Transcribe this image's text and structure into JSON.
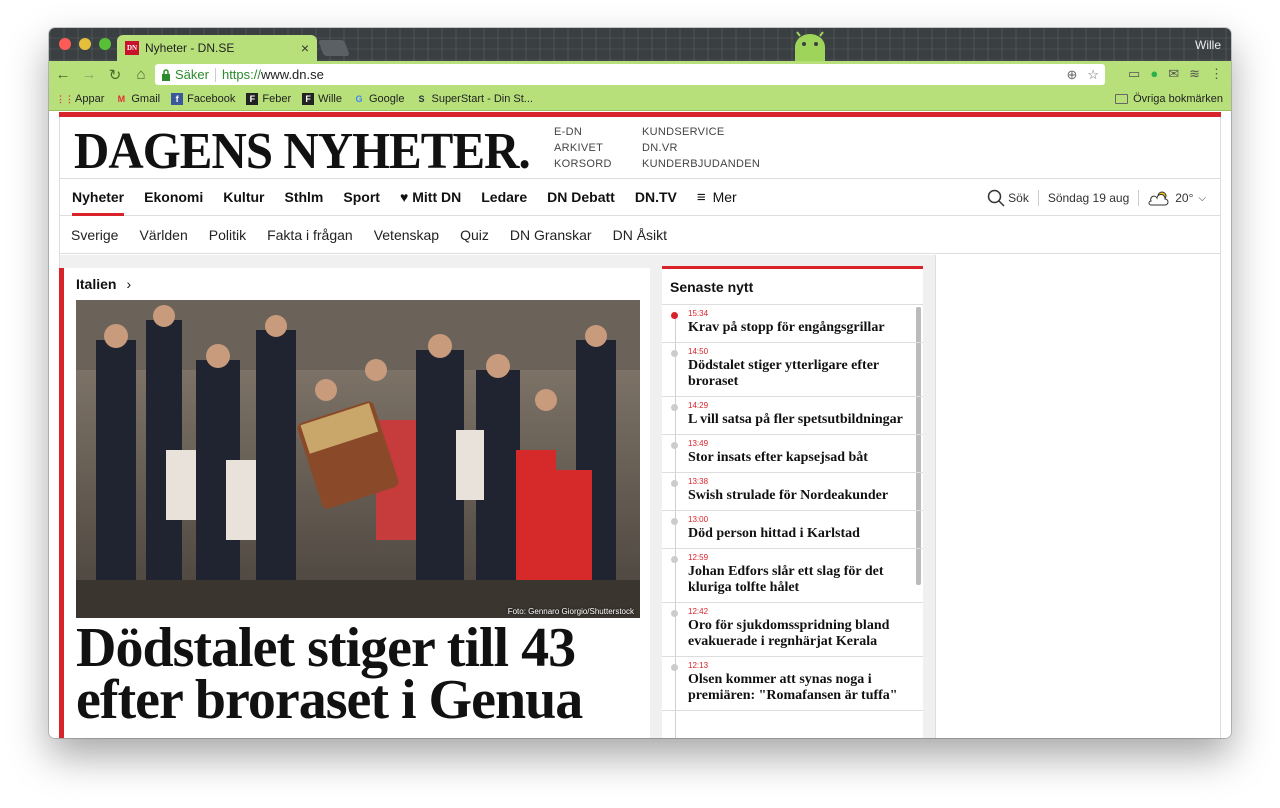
{
  "browser": {
    "tab_title": "Nyheter - DN.SE",
    "tab_close": "×",
    "favicon_text": "DN",
    "user": "Wille",
    "secure_label": "Säker",
    "url_proto": "https://",
    "url_host": "www.dn.se"
  },
  "bookmarks": {
    "items": [
      {
        "label": "Appar",
        "icon": "apps-grid-icon"
      },
      {
        "label": "Gmail",
        "icon": "gmail-icon"
      },
      {
        "label": "Facebook",
        "icon": "facebook-icon"
      },
      {
        "label": "Feber",
        "icon": "feber-icon"
      },
      {
        "label": "Wille",
        "icon": "wille-icon"
      },
      {
        "label": "Google",
        "icon": "google-icon"
      },
      {
        "label": "SuperStart - Din St...",
        "icon": "superstart-icon"
      }
    ],
    "other": "Övriga bokmärken"
  },
  "masthead": {
    "title": "DAGENS NYHETER.",
    "links_col1": [
      "E-DN",
      "ARKIVET",
      "KORSORD"
    ],
    "links_col2": [
      "KUNDSERVICE",
      "DN.VR",
      "KUNDERBJUDANDEN"
    ]
  },
  "nav": {
    "items": [
      "Nyheter",
      "Ekonomi",
      "Kultur",
      "Sthlm",
      "Sport",
      "Mitt DN",
      "Ledare",
      "DN Debatt",
      "DN.TV"
    ],
    "more": "Mer",
    "search": "Sök",
    "date": "Söndag 19 aug",
    "temperature": "20°"
  },
  "subnav": {
    "items": [
      "Sverige",
      "Världen",
      "Politik",
      "Fakta i frågan",
      "Vetenskap",
      "Quiz",
      "DN Granskar",
      "DN Åsikt"
    ]
  },
  "main_article": {
    "kicker": "Italien",
    "photo_credit": "Foto: Gennaro Giorgio/Shutterstock",
    "headline": "Dödstalet stiger till 43 efter broraset i Genua"
  },
  "latest_news": {
    "title": "Senaste nytt",
    "items": [
      {
        "time": "15:34",
        "headline": "Krav på stopp för engångsgrillar",
        "live": true
      },
      {
        "time": "14:50",
        "headline": "Dödstalet stiger ytterligare efter broraset",
        "live": false
      },
      {
        "time": "14:29",
        "headline": "L vill satsa på fler spetsutbildningar",
        "live": false
      },
      {
        "time": "13:49",
        "headline": "Stor insats efter kapsejsad båt",
        "live": false
      },
      {
        "time": "13:38",
        "headline": "Swish strulade för Nordeakunder",
        "live": false
      },
      {
        "time": "13:00",
        "headline": "Död person hittad i Karlstad",
        "live": false
      },
      {
        "time": "12:59",
        "headline": "Johan Edfors slår ett slag för det kluriga tolfte hålet",
        "live": false
      },
      {
        "time": "12:42",
        "headline": "Oro för sjukdomsspridning bland evakuerade i regnhärjat Kerala",
        "live": false
      },
      {
        "time": "12:13",
        "headline": "Olsen kommer att synas noga i premiären: \"Romafansen är tuffa\"",
        "live": false
      }
    ]
  },
  "colors": {
    "accent": "#d8232a",
    "chrome": "#b7e07a"
  }
}
